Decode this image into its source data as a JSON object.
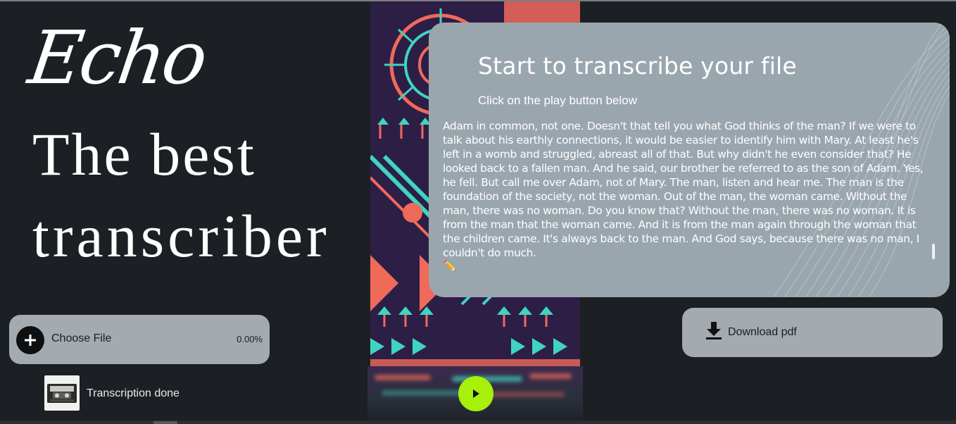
{
  "brand": {
    "logo": "Echo",
    "headline_line1": "The best",
    "headline_line2": "transcriber"
  },
  "card": {
    "title": "Start to transcribe your file",
    "subtitle": "Click on the play button below",
    "transcript": "Adam in common, not one. Doesn't that tell you what God thinks of the man? If we were to talk about his earthly connections, it would be easier to identify him with Mary. At least he's left in a womb and struggled, abreast all of that. But why didn't he even consider that? He looked back to a fallen man. And he said, our brother be referred to as the son of Adam. Yes, he fell. But call me over Adam, not of Mary. The man, listen and hear me. The man is the foundation of the society, not the woman. Out of the man, the woman came. Without the man, there was no woman. Do you know that? Without the man, there was no woman. It is from the man that the woman came. And it is from the man again through the woman that the children came. It's always back to the man. And God says, because there was no man, I couldn't do much.",
    "edit_glyph": "✏️"
  },
  "upload": {
    "choose_label": "Choose File",
    "progress": "0.00%",
    "status": "Transcription done"
  },
  "download": {
    "label": "Download pdf"
  },
  "colors": {
    "play": "#a6f00a",
    "card": "#9aa6ad",
    "background": "#1c1f23"
  },
  "icons": [
    "plus-icon",
    "play-icon",
    "download-icon",
    "pencil-icon",
    "cassette-icon"
  ]
}
